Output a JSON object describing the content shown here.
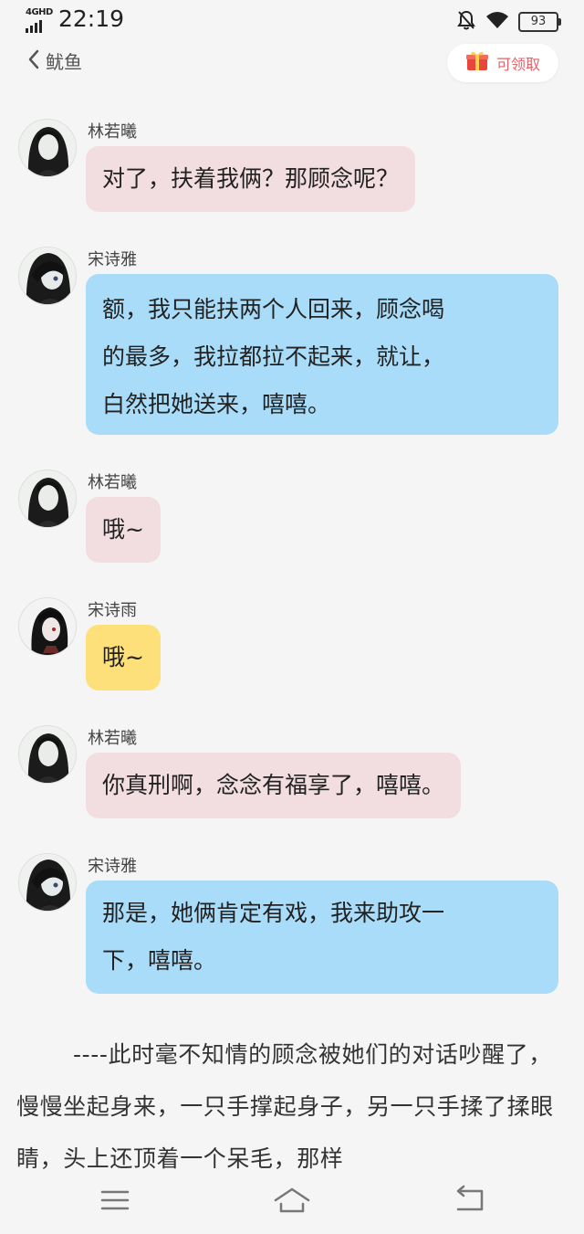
{
  "status": {
    "network": "4GHD",
    "time": "22:19",
    "battery": "93"
  },
  "nav": {
    "back_title": "鱿鱼",
    "claim_label": "可领取"
  },
  "messages": [
    {
      "name": "林若曦",
      "text": "对了，扶着我俩？那顾念呢？",
      "color": "#f2dde1"
    },
    {
      "name": "宋诗雅",
      "lines": [
        "额，我只能扶两个人回来，顾念喝",
        "的最多，我拉都拉不起来，就让，",
        "白然把她送来，嘻嘻。"
      ],
      "color": "#a9dcf8"
    },
    {
      "name": "林若曦",
      "text": "哦~",
      "color": "#f2dde1"
    },
    {
      "name": "宋诗雨",
      "text": "哦~",
      "color": "#fde07a"
    },
    {
      "name": "林若曦",
      "text": "你真刑啊，念念有福享了，嘻嘻。",
      "color": "#f2dde1"
    },
    {
      "name": "宋诗雅",
      "lines": [
        "那是，她俩肯定有戏，我来助攻一",
        "下，嘻嘻。"
      ],
      "color": "#a9dcf8"
    }
  ],
  "narration": "----此时毫不知情的顾念被她们的对话吵醒了，慢慢坐起身来，一只手撑起身子，另一只手揉了揉眼睛，头上还顶着一个呆毛，那样",
  "icons": [
    "bell-off-icon",
    "wifi-icon",
    "battery-icon",
    "chevron-left-icon",
    "gift-icon",
    "menu-icon",
    "home-icon",
    "return-icon"
  ]
}
